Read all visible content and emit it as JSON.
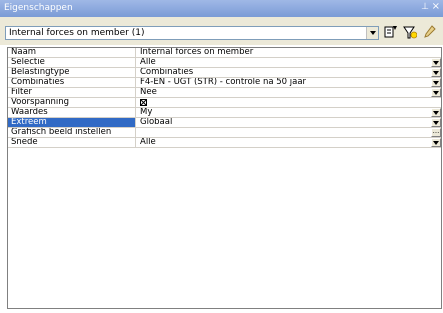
{
  "window": {
    "title": "Eigenschappen",
    "pin_icon": "pin-icon",
    "close_icon": "close-icon"
  },
  "toolbar": {
    "selected": "Internal forces on member (1)",
    "icons": [
      "select-by-property-icon",
      "filter-icon",
      "edit-icon"
    ]
  },
  "properties": [
    {
      "name": "Naam",
      "value": "Internal forces on member",
      "control": "text"
    },
    {
      "name": "Selectie",
      "value": "Alle",
      "control": "dropdown"
    },
    {
      "name": "Belastingtype",
      "value": "Combinaties",
      "control": "dropdown"
    },
    {
      "name": "Combinaties",
      "value": "F4-EN - UGT (STR) - controle na 50 jaar",
      "control": "dropdown"
    },
    {
      "name": "Filter",
      "value": "Nee",
      "control": "dropdown"
    },
    {
      "name": "Voorspanning",
      "value": "",
      "control": "checkbox",
      "checked": true
    },
    {
      "name": "Waardes",
      "value": "My",
      "control": "dropdown"
    },
    {
      "name": "Extreem",
      "value": "Globaal",
      "control": "dropdown",
      "selected": true
    },
    {
      "name": "Grafisch beeld instellen",
      "value": "",
      "control": "ellipsis"
    },
    {
      "name": "Snede",
      "value": "Alle",
      "control": "dropdown"
    }
  ],
  "colors": {
    "title_bar": "#7b9bd6",
    "selection": "#316ac5"
  }
}
